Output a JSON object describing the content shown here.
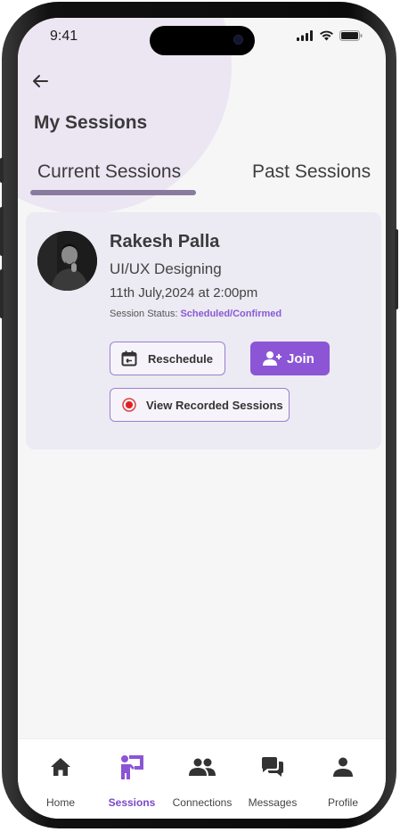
{
  "status_bar": {
    "time": "9:41"
  },
  "header": {
    "title": "My Sessions"
  },
  "tabs": {
    "current": "Current Sessions",
    "past": "Past Sessions"
  },
  "session": {
    "name": "Rakesh Palla",
    "topic": "UI/UX Designing",
    "datetime": "11th July,2024 at 2:00pm",
    "status_label": "Session Status:",
    "status_value": "Scheduled/Confirmed",
    "reschedule_label": "Reschedule",
    "join_label": "Join",
    "recorded_label": "View Recorded Sessions"
  },
  "nav": {
    "home": "Home",
    "sessions": "Sessions",
    "connections": "Connections",
    "messages": "Messages",
    "profile": "Profile"
  },
  "colors": {
    "accent": "#8b55d6",
    "status_value": "#8a5ad4",
    "card_bg": "#eceaf2",
    "tab_indicator": "#8a7a9e"
  }
}
